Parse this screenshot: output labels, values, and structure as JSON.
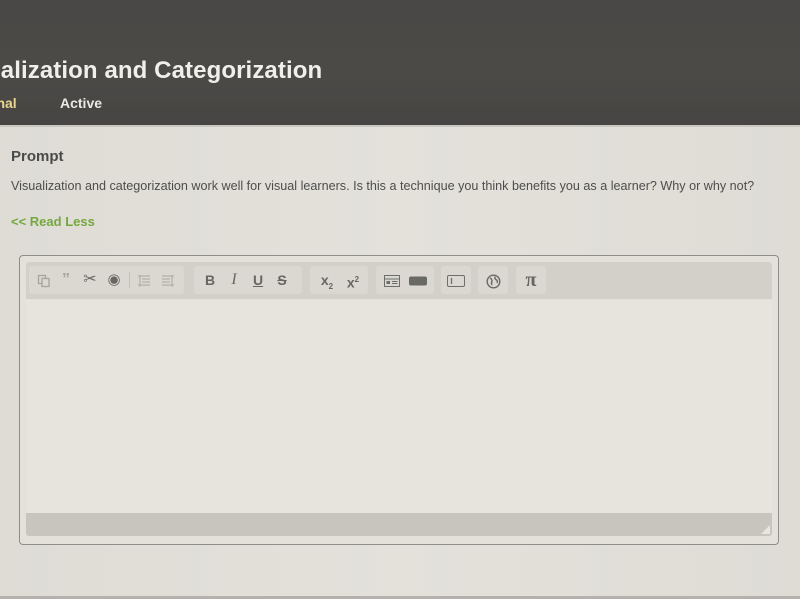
{
  "header": {
    "title": "ualization and Categorization",
    "tabs": [
      {
        "label": "rnal",
        "state": "selected"
      },
      {
        "label": "Active",
        "state": "default"
      }
    ]
  },
  "prompt": {
    "heading": "Prompt",
    "text": "Visualization and categorization work well for visual learners. Is this a technique you think benefits you as a learner? Why or why not?",
    "toggle_link": "<< Read Less"
  },
  "editor": {
    "value": "",
    "toolbar": {
      "paste": {
        "icon": "paste-icon"
      },
      "quote": {
        "icon": "quote-icon",
        "glyph": "”"
      },
      "cut": {
        "icon": "scissors-icon",
        "glyph": "✂"
      },
      "record": {
        "icon": "record-icon",
        "glyph": "◉"
      },
      "indent": {
        "icon": "indent-icon"
      },
      "outdent": {
        "icon": "outdent-icon"
      },
      "bold": {
        "label": "B"
      },
      "italic": {
        "label": "I"
      },
      "underline": {
        "label": "U"
      },
      "strikethrough": {
        "label": "S"
      },
      "subscript": {
        "label": "x",
        "sub": "2"
      },
      "superscript": {
        "label": "x",
        "sup": "2"
      },
      "table": {
        "icon": "table-icon"
      },
      "block": {
        "icon": "block-icon"
      },
      "text_box": {
        "icon": "textbox-icon"
      },
      "link": {
        "icon": "globe-icon"
      },
      "math": {
        "label": "π"
      }
    }
  },
  "colors": {
    "header_bg": "#4a4846",
    "title_text": "#efefec",
    "selected_tab": "#e9d68f",
    "link_green": "#74a83e",
    "page_bg": "#e0ded7"
  }
}
